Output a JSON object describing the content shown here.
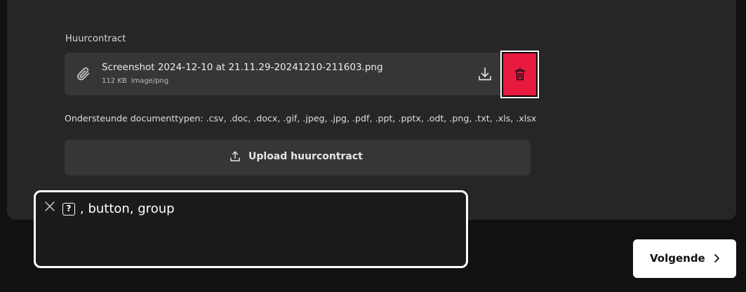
{
  "form": {
    "field_label": "Huurcontract",
    "file": {
      "name": "Screenshot 2024-12-10 at 21.11.29-20241210-211603.png",
      "size": "112 KB",
      "type": "image/png"
    },
    "supported_types": "Ondersteunde documenttypen: .csv, .doc, .docx, .gif, .jpeg, .jpg, .pdf, .ppt, .pptx, .odt, .png, .txt, .xls, .xlsx",
    "upload_label": "Upload huurcontract"
  },
  "tooltip": {
    "icon_glyph": "?",
    "text": ", button, group"
  },
  "footer": {
    "next_label": "Volgende"
  },
  "colors": {
    "background": "#111111",
    "card": "#262626",
    "row": "#363636",
    "delete": "#e8193e"
  },
  "icons": [
    "paperclip-icon",
    "download-icon",
    "trash-icon",
    "upload-icon",
    "close-icon",
    "question-icon",
    "chevron-right-icon"
  ]
}
